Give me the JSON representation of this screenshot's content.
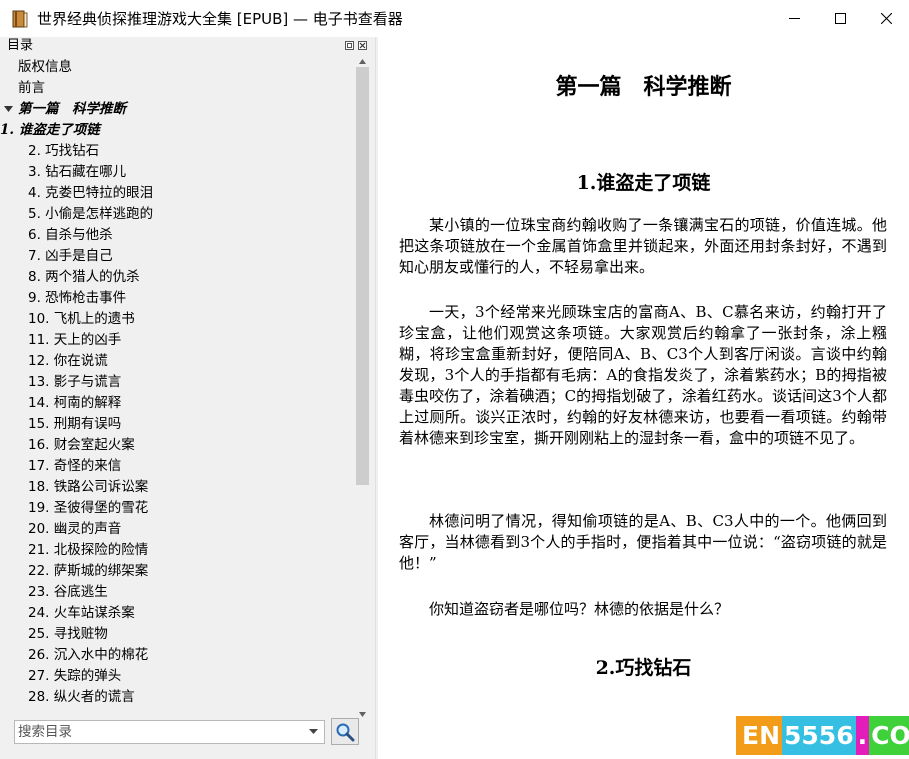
{
  "window": {
    "title": "世界经典侦探推理游戏大全集 [EPUB] — 电子书查看器",
    "minimize_icon": "minimize-icon",
    "maximize_icon": "maximize-icon",
    "close_icon": "close-icon"
  },
  "toc": {
    "title": "目录",
    "items": [
      {
        "label": "版权信息",
        "kind": "lvl0"
      },
      {
        "label": "前言",
        "kind": "lvl0"
      },
      {
        "label": "第一篇　科学推断",
        "kind": "part"
      },
      {
        "label": "1. 谁盗走了项链",
        "kind": "current"
      },
      {
        "label": "2. 巧找钻石",
        "kind": "lvl1"
      },
      {
        "label": "3. 钻石藏在哪儿",
        "kind": "lvl1"
      },
      {
        "label": "4. 克娄巴特拉的眼泪",
        "kind": "lvl1"
      },
      {
        "label": "5. 小偷是怎样逃跑的",
        "kind": "lvl1"
      },
      {
        "label": "6. 自杀与他杀",
        "kind": "lvl1"
      },
      {
        "label": "7. 凶手是自己",
        "kind": "lvl1"
      },
      {
        "label": "8. 两个猎人的仇杀",
        "kind": "lvl1"
      },
      {
        "label": "9. 恐怖枪击事件",
        "kind": "lvl1"
      },
      {
        "label": "10. 飞机上的遗书",
        "kind": "lvl1"
      },
      {
        "label": "11. 天上的凶手",
        "kind": "lvl1"
      },
      {
        "label": "12. 你在说谎",
        "kind": "lvl1"
      },
      {
        "label": "13. 影子与谎言",
        "kind": "lvl1"
      },
      {
        "label": "14. 柯南的解释",
        "kind": "lvl1"
      },
      {
        "label": "15. 刑期有误吗",
        "kind": "lvl1"
      },
      {
        "label": "16. 财会室起火案",
        "kind": "lvl1"
      },
      {
        "label": "17. 奇怪的来信",
        "kind": "lvl1"
      },
      {
        "label": "18. 铁路公司诉讼案",
        "kind": "lvl1"
      },
      {
        "label": "19. 圣彼得堡的雪花",
        "kind": "lvl1"
      },
      {
        "label": "20. 幽灵的声音",
        "kind": "lvl1"
      },
      {
        "label": "21. 北极探险的险情",
        "kind": "lvl1"
      },
      {
        "label": "22. 萨斯城的绑架案",
        "kind": "lvl1"
      },
      {
        "label": "23. 谷底逃生",
        "kind": "lvl1"
      },
      {
        "label": "24. 火车站谋杀案",
        "kind": "lvl1"
      },
      {
        "label": "25. 寻找赃物",
        "kind": "lvl1"
      },
      {
        "label": "26. 沉入水中的棉花",
        "kind": "lvl1"
      },
      {
        "label": "27. 失踪的弹头",
        "kind": "lvl1"
      },
      {
        "label": "28. 纵火者的谎言",
        "kind": "lvl1"
      }
    ],
    "search_placeholder": "搜索目录",
    "search_icon": "magnifier-icon"
  },
  "content": {
    "part_title": "第一篇　科学推断",
    "chapter1_title": "1.谁盗走了项链",
    "paragraphs": [
      "某小镇的一位珠宝商约翰收购了一条镶满宝石的项链，价值连城。他把这条项链放在一个金属首饰盒里并锁起来，外面还用封条封好，不遇到知心朋友或懂行的人，不轻易拿出来。",
      "一天，3个经常来光顾珠宝店的富商A、B、C慕名来访，约翰打开了珍宝盒，让他们观赏这条项链。大家观赏后约翰拿了一张封条，涂上糨糊，将珍宝盒重新封好，便陪同A、B、C3个人到客厅闲谈。言谈中约翰发现，3个人的手指都有毛病：A的食指发炎了，涂着紫药水；B的拇指被毒虫咬伤了，涂着碘酒；C的拇指划破了，涂着红药水。谈话间这3个人都上过厕所。谈兴正浓时，约翰的好友林德来访，也要看一看项链。约翰带着林德来到珍宝室，撕开刚刚粘上的湿封条一看，盒中的项链不见了。",
      "林德问明了情况，得知偷项链的是A、B、C3人中的一个。他俩回到客厅，当林德看到3个人的手指时，便指着其中一位说：“盗窃项链的就是他！”",
      "你知道盗窃者是哪位吗？林德的依据是什么？"
    ],
    "chapter2_title": "2.巧找钻石"
  },
  "watermark": {
    "a": "EN",
    "b": "5556",
    "c": ".",
    "d": "COM"
  }
}
